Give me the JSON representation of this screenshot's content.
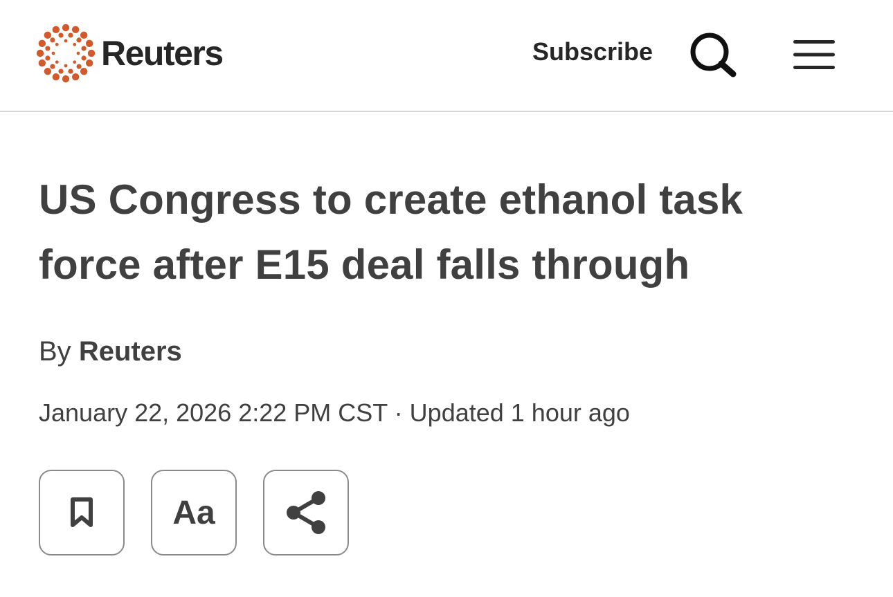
{
  "header": {
    "brand": "Reuters",
    "brand_color": "#d2592a",
    "subscribe_label": "Subscribe",
    "search_icon": "search-icon",
    "menu_icon": "hamburger-menu-icon"
  },
  "article": {
    "headline": "US Congress to create ethanol task force after E15 deal falls through",
    "byline_prefix": "By",
    "author": "Reuters",
    "published": "January 22, 2026 2:22 PM CST",
    "separator": "·",
    "updated": "Updated 1 hour ago"
  },
  "toolbar": {
    "bookmark_icon": "bookmark-icon",
    "text_size_label": "Aa",
    "share_icon": "share-icon"
  }
}
